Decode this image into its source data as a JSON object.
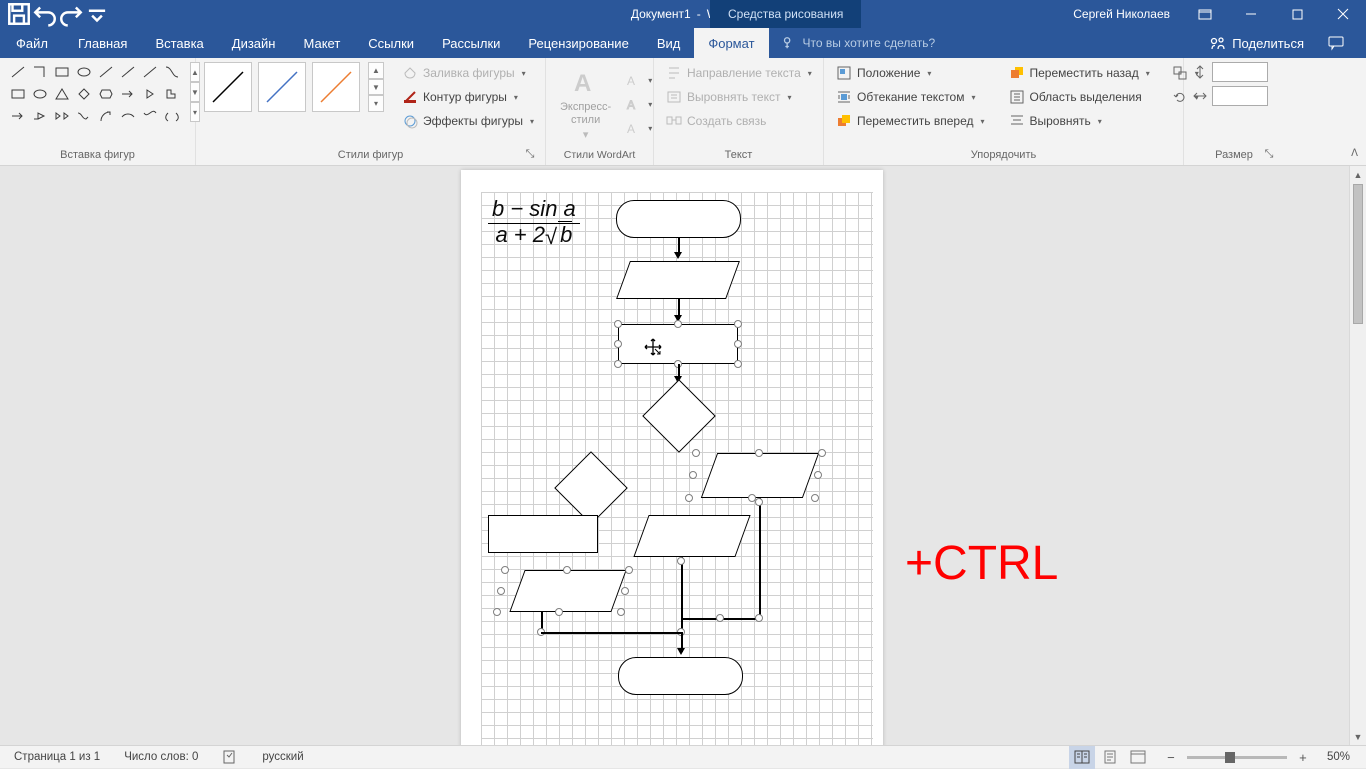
{
  "title": {
    "doc": "Документ1",
    "app": "Word",
    "context": "Средства рисования"
  },
  "user": "Сергей Николаев",
  "tabs": {
    "file": "Файл",
    "home": "Главная",
    "insert": "Вставка",
    "design": "Дизайн",
    "layout": "Макет",
    "refs": "Ссылки",
    "mail": "Рассылки",
    "review": "Рецензирование",
    "view": "Вид",
    "format": "Формат"
  },
  "tellme": "Что вы хотите сделать?",
  "share": "Поделиться",
  "ribbon": {
    "insertShapes": "Вставка фигур",
    "shapeStyles": "Стили фигур",
    "shapeFill": "Заливка фигуры",
    "shapeOutline": "Контур фигуры",
    "shapeEffects": "Эффекты фигуры",
    "wordartStyles": "Стили WordArt",
    "express": "Экспресс-стили",
    "text": "Текст",
    "textDir": "Направление текста",
    "alignText": "Выровнять текст",
    "createLink": "Создать связь",
    "arrange": "Упорядочить",
    "position": "Положение",
    "wrap": "Обтекание текстом",
    "forward": "Переместить вперед",
    "backward": "Переместить назад",
    "selection": "Область выделения",
    "align": "Выровнять",
    "size": "Размер"
  },
  "status": {
    "page": "Страница 1 из 1",
    "words": "Число слов: 0",
    "lang": "русский",
    "zoom": "50%"
  },
  "equation": {
    "num": "b − sin a",
    "den_pre": "a + 2",
    "den_rad": "b"
  },
  "annotation": "+CTRL"
}
